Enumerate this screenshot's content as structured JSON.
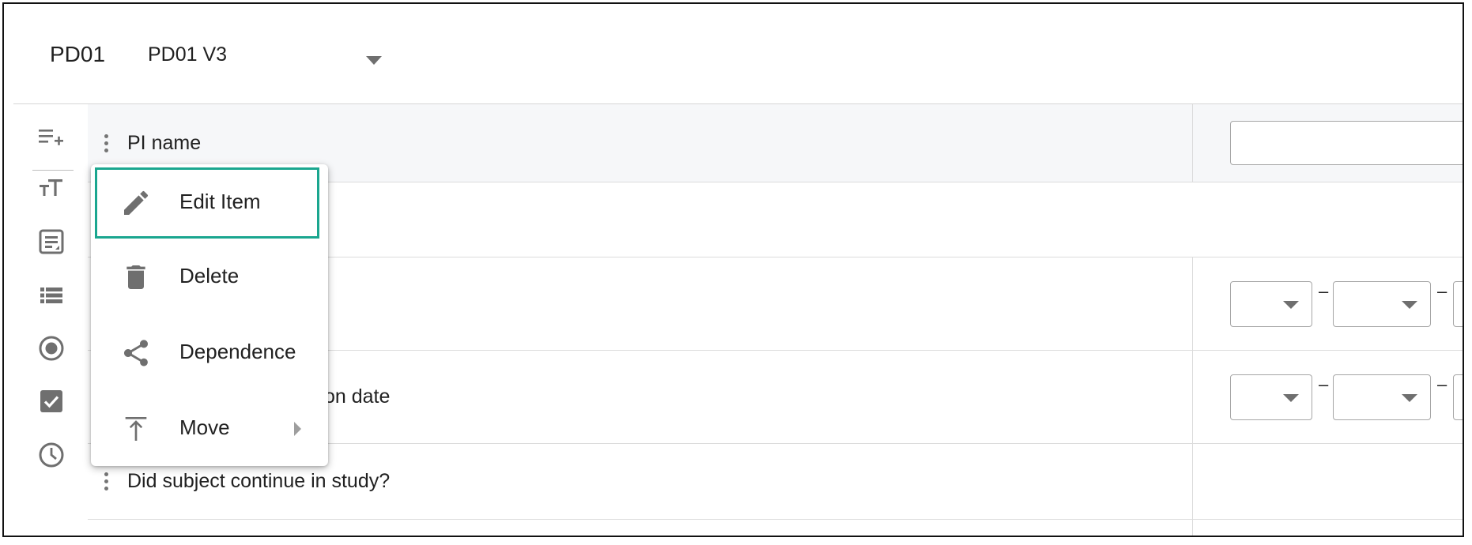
{
  "header": {
    "form_code": "PD01",
    "version": {
      "selected": "PD01 V3"
    }
  },
  "toolbar": {
    "tools": [
      "add-item-icon",
      "text-size-icon",
      "text-field-icon",
      "list-icon",
      "radio-icon",
      "checkbox-icon",
      "clock-icon"
    ]
  },
  "rows": [
    {
      "label": "PI name"
    },
    {
      "label": ""
    },
    {
      "label": ""
    },
    {
      "label": "on date"
    },
    {
      "label": "Did subject continue in study?"
    }
  ],
  "date_separator": "–",
  "context_menu": {
    "items": [
      {
        "label": "Edit Item",
        "icon": "pencil-icon",
        "highlighted": true
      },
      {
        "label": "Delete",
        "icon": "trash-icon"
      },
      {
        "label": "Dependence",
        "icon": "share-icon"
      },
      {
        "label": "Move",
        "icon": "move-to-top-icon",
        "has_submenu": true
      }
    ]
  },
  "colors": {
    "highlight_outline": "#1aa68f",
    "icon_gray": "#6f6f6f"
  }
}
